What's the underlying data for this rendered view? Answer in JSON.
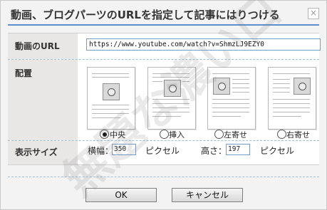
{
  "dialog": {
    "title": "動画、ブログパーツのURLを指定して記事にはりつける",
    "close_glyph": "×"
  },
  "url_row": {
    "label": "動画のURL",
    "value": "https://www.youtube.com/watch?v=ShmzLJ9EZY0"
  },
  "layout_row": {
    "label": "配置",
    "options": [
      {
        "label": "中央",
        "checked": true
      },
      {
        "label": "挿入",
        "checked": false
      },
      {
        "label": "左寄せ",
        "checked": false
      },
      {
        "label": "右寄せ",
        "checked": false
      }
    ]
  },
  "size_row": {
    "label": "表示サイズ",
    "width_label": "横幅：",
    "width_value": "350",
    "width_unit": "ピクセル",
    "height_label": "高さ：",
    "height_value": "197",
    "height_unit": "ピクセル"
  },
  "buttons": {
    "ok": "OK",
    "cancel": "キャンセル"
  },
  "watermark_text": "無題な濃い口"
}
